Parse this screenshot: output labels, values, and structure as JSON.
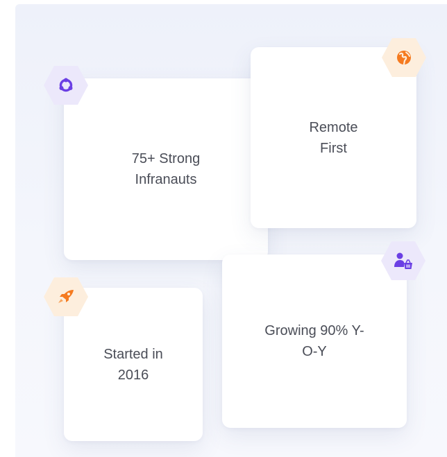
{
  "cards": [
    {
      "text": "75+ Strong Infranauts",
      "icon": "team-circle-icon"
    },
    {
      "text": "Remote First",
      "icon": "globe-icon"
    },
    {
      "text": "Started in 2016",
      "icon": "rocket-icon"
    },
    {
      "text": "Growing 90% Y-O-Y",
      "icon": "user-basket-icon"
    }
  ],
  "colors": {
    "purple": "#6b3fe4",
    "purple_bg": "#ece8fb",
    "orange": "#f57a1f",
    "orange_bg": "#fdeedd",
    "text": "#4a4d57"
  }
}
